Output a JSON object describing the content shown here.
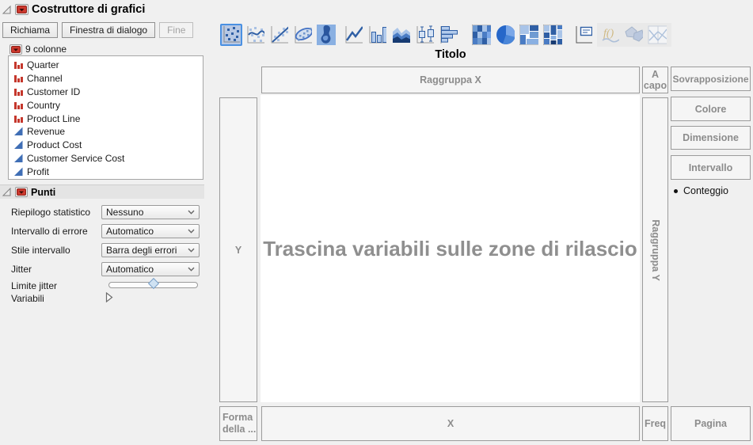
{
  "window": {
    "title": "Costruttore di grafici"
  },
  "header_buttons": {
    "richiama": "Richiama",
    "finestra_di_dialogo": "Finestra di dialogo",
    "fine": "Fine"
  },
  "columns": {
    "header": "9 colonne",
    "items": [
      {
        "name": "Quarter",
        "icon": "red-bars-icon"
      },
      {
        "name": "Channel",
        "icon": "red-bars-icon"
      },
      {
        "name": "Customer ID",
        "icon": "red-bars-icon"
      },
      {
        "name": "Country",
        "icon": "red-bars-icon"
      },
      {
        "name": "Product Line",
        "icon": "red-bars-icon"
      },
      {
        "name": "Revenue",
        "icon": "blue-triangle-icon"
      },
      {
        "name": "Product Cost",
        "icon": "blue-triangle-icon"
      },
      {
        "name": "Customer Service Cost",
        "icon": "blue-triangle-icon"
      },
      {
        "name": "Profit",
        "icon": "blue-triangle-icon"
      }
    ]
  },
  "punti_panel": {
    "title": "Punti",
    "rows": [
      {
        "label": "Riepilogo statistico",
        "value": "Nessuno"
      },
      {
        "label": "Intervallo di errore",
        "value": "Automatico"
      },
      {
        "label": "Stile intervallo",
        "value": "Barra degli errori"
      },
      {
        "label": "Jitter",
        "value": "Automatico"
      }
    ],
    "slider_label": "Limite jitter",
    "variables_label": "Variabili"
  },
  "element_palette": {
    "icons": [
      "points",
      "smoother",
      "line-of-fit",
      "ellipse",
      "contour",
      "line",
      "bar",
      "area",
      "box-plot",
      "histogram",
      "heatmap",
      "pie",
      "treemap",
      "mosaic",
      "caption-box",
      "formula",
      "map-shapes",
      "parallel"
    ],
    "selected": "points",
    "disabled": [
      "formula",
      "map-shapes",
      "parallel"
    ]
  },
  "canvas": {
    "title": "Titolo",
    "placeholder": "Trascina variabili sulle zone di rilascio",
    "legend_item": "Conteggio"
  },
  "zones": {
    "raggruppa_x": "Raggruppa X",
    "a_capo": "A capo",
    "sovrapposizione": "Sovrapposizione",
    "colore": "Colore",
    "dimensione": "Dimensione",
    "intervallo": "Intervallo",
    "y": "Y",
    "raggruppa_y": "Raggruppa Y",
    "forma_line1": "Forma",
    "forma_line2": "della ...",
    "x": "X",
    "freq": "Freq",
    "pagina": "Pagina"
  },
  "colors": {
    "accent_blue": "#2f5fa5",
    "categorical_red": "#c53a30",
    "selected_tool_bg": "#b7c8e4",
    "selected_tool_border": "#4a90e2"
  }
}
